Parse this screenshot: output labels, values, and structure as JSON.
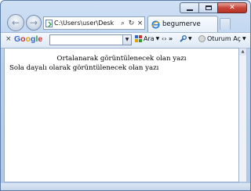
{
  "browser": {
    "address_url": "C:\\Users\\user\\Desk",
    "tab_title": "begumerve"
  },
  "google_toolbar": {
    "logo_letters": [
      "G",
      "o",
      "o",
      "g",
      "l",
      "e"
    ],
    "logo_colors": [
      "#3366cc",
      "#cc3333",
      "#e0a000",
      "#3366cc",
      "#339933",
      "#cc3333"
    ],
    "ara_label": "Ara",
    "more_label": "»",
    "signin_label": "Oturum Aç"
  },
  "content": {
    "centered_text": "Ortalanarak görüntülenecek olan yazı",
    "left_text": "Sola dayalı olarak görüntülenecek olan yazı"
  },
  "icons": {
    "back": "arrow-left-icon",
    "forward": "arrow-right-icon",
    "search": "search-icon",
    "refresh": "refresh-icon",
    "stop": "close-icon"
  }
}
